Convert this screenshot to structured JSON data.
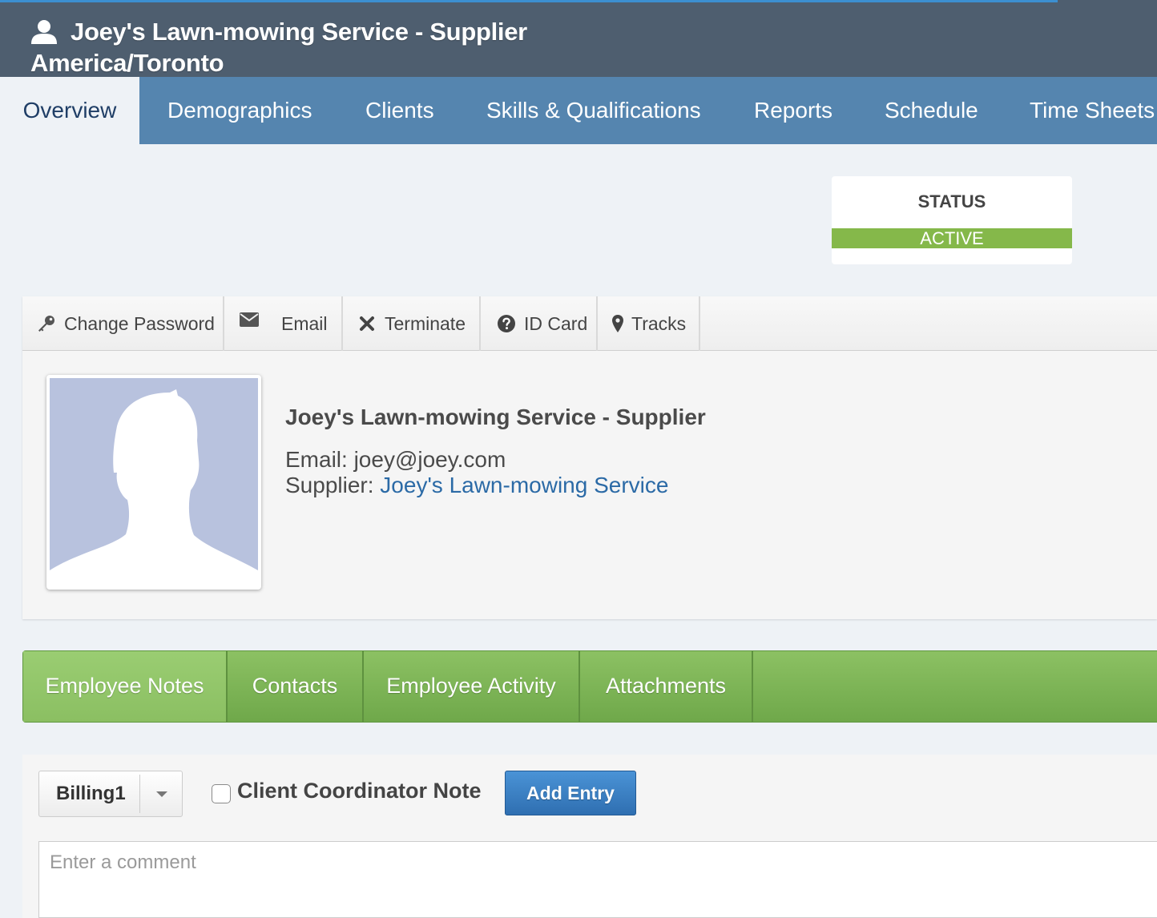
{
  "header": {
    "title": "Joey's Lawn-mowing Service - Supplier",
    "timezone": "America/Toronto",
    "user_icon": "user-icon"
  },
  "nav": {
    "tabs": [
      {
        "label": "Overview",
        "active": true
      },
      {
        "label": "Demographics"
      },
      {
        "label": "Clients"
      },
      {
        "label": "Skills & Qualifications"
      },
      {
        "label": "Reports"
      },
      {
        "label": "Schedule"
      },
      {
        "label": "Time Sheets"
      }
    ]
  },
  "status": {
    "label": "STATUS",
    "value": "ACTIVE",
    "color": "#85b84a"
  },
  "actions": [
    {
      "label": "Change Password",
      "icon": "key-icon"
    },
    {
      "label": "Email",
      "icon": "envelope-icon"
    },
    {
      "label": "Terminate",
      "icon": "close-icon"
    },
    {
      "label": "ID Card",
      "icon": "question-circle-icon"
    },
    {
      "label": "Tracks",
      "icon": "map-marker-icon"
    }
  ],
  "profile": {
    "name": "Joey's Lawn-mowing Service - Supplier",
    "email_label": "Email:",
    "email": "joey@joey.com",
    "supplier_label": "Supplier:",
    "supplier": "Joey's Lawn-mowing Service"
  },
  "sub_tabs": [
    {
      "label": "Employee Notes",
      "active": true
    },
    {
      "label": "Contacts"
    },
    {
      "label": "Employee Activity"
    },
    {
      "label": "Attachments"
    }
  ],
  "notes": {
    "category": "Billing1",
    "checkbox_label": "Client Coordinator Note",
    "checkbox_checked": false,
    "add_button": "Add Entry",
    "comment_placeholder": "Enter a comment",
    "comment_value": ""
  },
  "colors": {
    "header_bg": "#4e5e6f",
    "nav_bg": "#5585af",
    "accent_green": "#85b84a",
    "link_blue": "#2b6aa6",
    "button_blue": "#3a80c4"
  }
}
